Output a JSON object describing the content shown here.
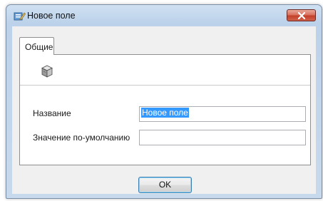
{
  "window": {
    "title": "Новое поле"
  },
  "tabs": [
    {
      "label": "Общие",
      "active": true
    }
  ],
  "form": {
    "name_label": "Название",
    "name_value": "Новое поле",
    "default_label": "Значение по-умолчанию",
    "default_value": ""
  },
  "buttons": {
    "ok_label": "OK"
  },
  "icons": {
    "app": "app-icon",
    "close": "close-icon",
    "field": "field-cube-icon"
  }
}
